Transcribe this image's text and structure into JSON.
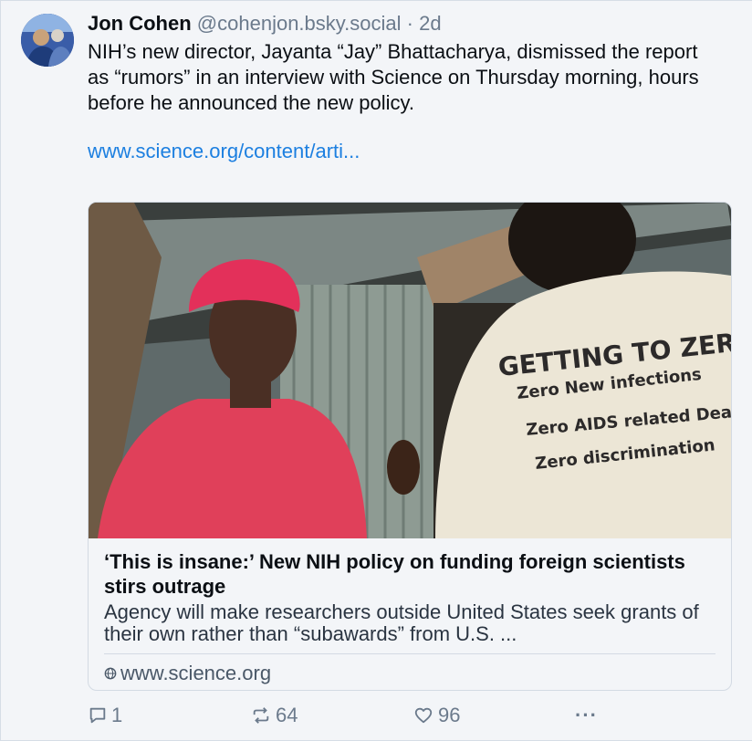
{
  "post": {
    "author_name": "Jon Cohen",
    "handle": "@cohenjon.bsky.social",
    "separator": "·",
    "time": "2d",
    "text": "NIH’s new director, Jayanta “Jay” Bhattacharya, dismissed the report as “rumors” in an interview with Science on Thursday morning, hours before he announced the new policy.",
    "link_text": "www.science.org/content/arti..."
  },
  "card": {
    "image_text": {
      "line1": "GETTING TO ZERO",
      "line2": "Zero New infections",
      "line3": "Zero AIDS related Deaths",
      "line4": "Zero discrimination"
    },
    "title": "‘This is insane:’ New NIH policy on funding foreign scientists stirs outrage",
    "description": "Agency will make researchers outside United States seek grants of their own rather than “subawards” from U.S. ...",
    "domain": "www.science.org"
  },
  "actions": {
    "reply_count": "1",
    "repost_count": "64",
    "like_count": "96",
    "more_label": "···"
  },
  "icons": {
    "reply": "speech-bubble-icon",
    "repost": "repost-arrows-icon",
    "like": "heart-icon",
    "more": "ellipsis-icon",
    "domain": "globe-icon"
  },
  "colors": {
    "link": "#1c7fe0",
    "muted": "#6b7a8c",
    "background": "#f3f5f8"
  }
}
